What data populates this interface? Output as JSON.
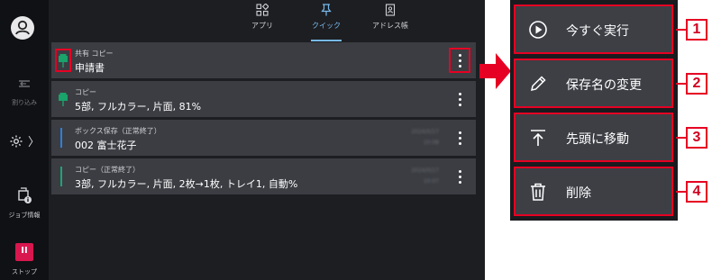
{
  "sidebar": {
    "interrupt_label": "割り込み",
    "job_info_label": "ジョブ情報",
    "stop_label": "ストップ",
    "stop_glyph": "II",
    "settings_chevron": "〉"
  },
  "tabs": [
    {
      "label": "アプリ",
      "icon": "apps-icon"
    },
    {
      "label": "クイック",
      "icon": "pin-icon",
      "active": true
    },
    {
      "label": "アドレス帳",
      "icon": "address-book-icon"
    }
  ],
  "jobs": [
    {
      "title": "共有 コピー",
      "detail": "申請書",
      "pinned": true
    },
    {
      "title": "コピー",
      "detail": "5部, フルカラー, 片面, 81%",
      "pinned": true
    },
    {
      "title": "ボックス保存（正常終了）",
      "detail": "002 富士花子",
      "stamp": "2024/0/17 10:08"
    },
    {
      "title": "コピー（正常終了）",
      "detail": "3部, フルカラー, 片面, 2枚→1枚, トレイ1, 自動%",
      "stamp": "2024/0/17 10:07"
    }
  ],
  "menu": [
    {
      "label": "今すぐ実行",
      "icon": "play-icon",
      "number": "1"
    },
    {
      "label": "保存名の変更",
      "icon": "pencil-icon",
      "number": "2"
    },
    {
      "label": "先頭に移動",
      "icon": "move-to-top-icon",
      "number": "3"
    },
    {
      "label": "削除",
      "icon": "trash-icon",
      "number": "4"
    }
  ],
  "colors": {
    "highlight": "#e60023",
    "pin_green": "#1aa36a",
    "box_blue": "#2f7fd6",
    "copy_teal": "#1fa37a",
    "active_tab": "#78b9ea",
    "stop_red": "#d8174f"
  }
}
